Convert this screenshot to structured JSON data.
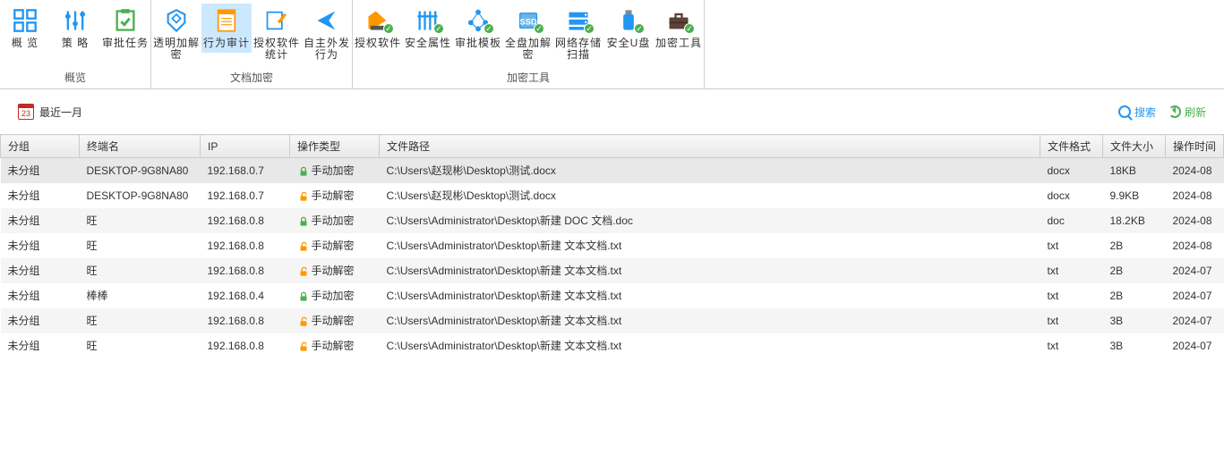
{
  "ribbon": {
    "groups": [
      {
        "label": "概览",
        "items": [
          {
            "key": "overview",
            "label": "概 览"
          },
          {
            "key": "policy",
            "label": "策 略"
          },
          {
            "key": "approval",
            "label": "审批任务"
          }
        ]
      },
      {
        "label": "文档加密",
        "items": [
          {
            "key": "transparent",
            "label": "透明加解密"
          },
          {
            "key": "audit",
            "label": "行为审计",
            "active": true
          },
          {
            "key": "software-stats",
            "label": "授权软件统计"
          },
          {
            "key": "outgoing",
            "label": "自主外发行为"
          }
        ]
      },
      {
        "label": "加密工具",
        "items": [
          {
            "key": "auth-software",
            "label": "授权软件"
          },
          {
            "key": "sec-attr",
            "label": "安全属性"
          },
          {
            "key": "template",
            "label": "审批模板"
          },
          {
            "key": "full-disk",
            "label": "全盘加解密"
          },
          {
            "key": "net-storage",
            "label": "网络存储扫描"
          },
          {
            "key": "usb",
            "label": "安全U盘"
          },
          {
            "key": "tools",
            "label": "加密工具"
          }
        ]
      }
    ]
  },
  "toolbar": {
    "calendar_day": "23",
    "date_range": "最近一月",
    "search_label": "搜索",
    "refresh_label": "刷新"
  },
  "table": {
    "headers": {
      "group": "分组",
      "terminal": "终端名",
      "ip": "IP",
      "op_type": "操作类型",
      "path": "文件路径",
      "format": "文件格式",
      "size": "文件大小",
      "op_time": "操作时间"
    },
    "rows": [
      {
        "group": "未分组",
        "terminal": "DESKTOP-9G8NA80",
        "ip": "192.168.0.7",
        "op_type": "手动加密",
        "op_kind": "encrypt",
        "path": "C:\\Users\\赵现彬\\Desktop\\测试.docx",
        "format": "docx",
        "size": "18KB",
        "op_time": "2024-08",
        "selected": true
      },
      {
        "group": "未分组",
        "terminal": "DESKTOP-9G8NA80",
        "ip": "192.168.0.7",
        "op_type": "手动解密",
        "op_kind": "decrypt",
        "path": "C:\\Users\\赵现彬\\Desktop\\测试.docx",
        "format": "docx",
        "size": "9.9KB",
        "op_time": "2024-08"
      },
      {
        "group": "未分组",
        "terminal": "旺",
        "ip": "192.168.0.8",
        "op_type": "手动加密",
        "op_kind": "encrypt",
        "path": "C:\\Users\\Administrator\\Desktop\\新建 DOC 文档.doc",
        "format": "doc",
        "size": "18.2KB",
        "op_time": "2024-08"
      },
      {
        "group": "未分组",
        "terminal": "旺",
        "ip": "192.168.0.8",
        "op_type": "手动解密",
        "op_kind": "decrypt",
        "path": "C:\\Users\\Administrator\\Desktop\\新建 文本文档.txt",
        "format": "txt",
        "size": "2B",
        "op_time": "2024-08"
      },
      {
        "group": "未分组",
        "terminal": "旺",
        "ip": "192.168.0.8",
        "op_type": "手动解密",
        "op_kind": "decrypt",
        "path": "C:\\Users\\Administrator\\Desktop\\新建 文本文档.txt",
        "format": "txt",
        "size": "2B",
        "op_time": "2024-07"
      },
      {
        "group": "未分组",
        "terminal": "棒棒",
        "ip": "192.168.0.4",
        "op_type": "手动加密",
        "op_kind": "encrypt",
        "path": "C:\\Users\\Administrator\\Desktop\\新建 文本文档.txt",
        "format": "txt",
        "size": "2B",
        "op_time": "2024-07"
      },
      {
        "group": "未分组",
        "terminal": "旺",
        "ip": "192.168.0.8",
        "op_type": "手动解密",
        "op_kind": "decrypt",
        "path": "C:\\Users\\Administrator\\Desktop\\新建 文本文档.txt",
        "format": "txt",
        "size": "3B",
        "op_time": "2024-07"
      },
      {
        "group": "未分组",
        "terminal": "旺",
        "ip": "192.168.0.8",
        "op_type": "手动解密",
        "op_kind": "decrypt",
        "path": "C:\\Users\\Administrator\\Desktop\\新建 文本文档.txt",
        "format": "txt",
        "size": "3B",
        "op_time": "2024-07"
      }
    ]
  },
  "colors": {
    "encrypt": "#4caf50",
    "decrypt": "#ff9800",
    "ribbon_active": "#cce8ff",
    "link": "#2196f3"
  }
}
